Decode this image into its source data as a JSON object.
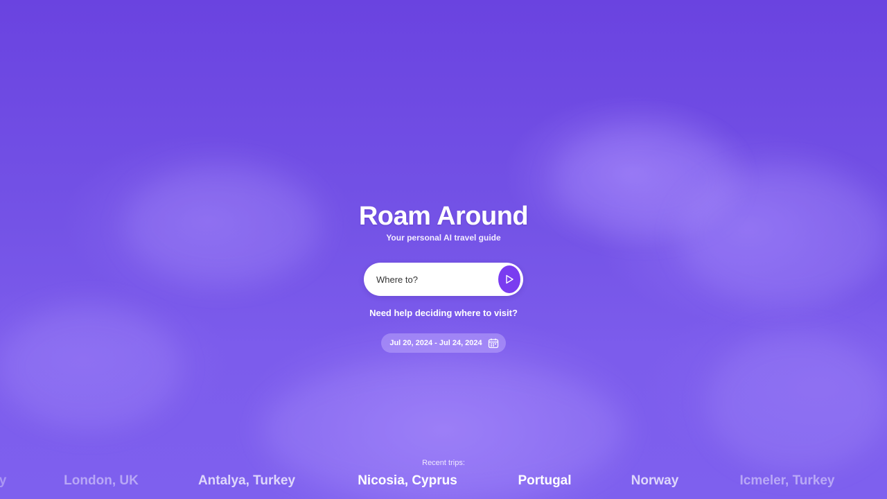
{
  "hero": {
    "title": "Roam Around",
    "subtitle": "Your personal AI travel guide"
  },
  "search": {
    "placeholder": "Where to?",
    "submit_icon": "play-arrow-icon"
  },
  "help_link": "Need help deciding where to visit?",
  "date_range": {
    "label": "Jul 20, 2024 - Jul 24, 2024",
    "icon": "calendar-icon"
  },
  "recent": {
    "label": "Recent trips:",
    "trips": [
      {
        "label": "y",
        "opacity": 0.35
      },
      {
        "label": "London, UK",
        "opacity": 0.45
      },
      {
        "label": "Antalya, Turkey",
        "opacity": 0.75
      },
      {
        "label": "Nicosia, Cyprus",
        "opacity": 1.0
      },
      {
        "label": "Portugal",
        "opacity": 1.0
      },
      {
        "label": "Norway",
        "opacity": 0.75
      },
      {
        "label": "Icmeler, Turkey",
        "opacity": 0.45
      }
    ]
  },
  "colors": {
    "background": "#6f49e0",
    "accent": "#7a3cf0",
    "text": "#ffffff"
  }
}
